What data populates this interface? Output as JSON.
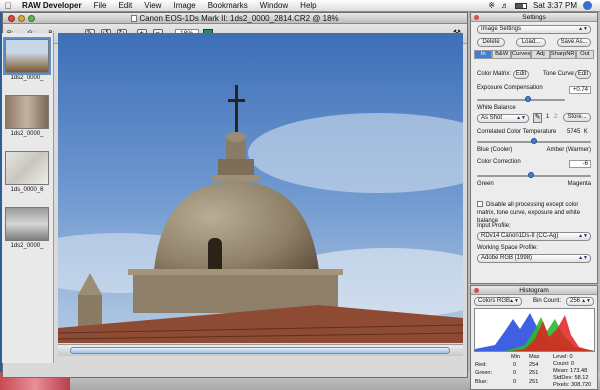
{
  "menubar": {
    "app": "RAW Developer",
    "items": [
      "File",
      "Edit",
      "View",
      "Image",
      "Bookmarks",
      "Window",
      "Help"
    ],
    "clock": "Sat 3:37 PM"
  },
  "image_window": {
    "title": "Canon EOS-1Ds Mark II: 1ds2_0000_2814.CR2 @ 18%",
    "toolbar": {
      "r_label": "R:",
      "g_label": "G:",
      "b_label": "B:",
      "zoom": "18%"
    },
    "thumbnails": [
      {
        "label": "1ds2_0000_"
      },
      {
        "label": "1ds2_0000_"
      },
      {
        "label": "1ds_0000_6"
      },
      {
        "label": "1ds2_0000_"
      }
    ]
  },
  "settings": {
    "title": "Settings",
    "preset": "Image Settings",
    "buttons": {
      "delete": "Delete",
      "load": "Load...",
      "save_as": "Save As..."
    },
    "tabs": [
      "In",
      "B&W",
      "Curves",
      "Adj",
      "SharpNR",
      "Out"
    ],
    "active_tab": "In",
    "color_matrix_label": "Color Matrix:",
    "color_matrix_btn": "Edit",
    "tone_curve_label": "Tone Curve:",
    "tone_curve_btn": "Edit",
    "exposure_label": "Exposure Compensation",
    "exposure_value": "+0.74",
    "exposure_level": 0.58,
    "wb_label": "White Balance",
    "wb_value": "As Shot",
    "wb_slot1": "1",
    "wb_slot2": "2",
    "store_btn": "Store...",
    "cct_label": "Correlated Color Temperature",
    "cct_value": "5745",
    "cct_unit": "K",
    "cct_level": 0.5,
    "cct_left": "Blue (Cooler)",
    "cct_right": "Amber (Warmer)",
    "cc_label": "Color Correction",
    "cc_value": "-6",
    "cc_level": 0.47,
    "cc_left": "Green",
    "cc_right": "Magenta",
    "disable_text": "Disable all processing except color matrix, tone curve, exposure and white balance",
    "input_profile_label": "Input Profile:",
    "input_profile_value": "RDv14 Canon1Ds-II (CC-Ag)",
    "ws_profile_label": "Working Space Profile:",
    "ws_profile_value": "Adobe RGB (1998)"
  },
  "histogram": {
    "title": "Histogram",
    "mode": "Colors RGB",
    "bin_label": "Bin Count:",
    "bin_value": "256",
    "headers": {
      "min": "Min",
      "max": "Max"
    },
    "rows": [
      {
        "label": "Red:",
        "min": "0",
        "max": "254"
      },
      {
        "label": "Green:",
        "min": "0",
        "max": "251"
      },
      {
        "label": "Blue:",
        "min": "0",
        "max": "251"
      }
    ],
    "stats": {
      "level": "Level: 0",
      "count": "Count: 0",
      "mean": "Mean: 173.48",
      "stddev": "StdDev: 58.12",
      "pixels": "Pixels: 308,720"
    },
    "colors": {
      "red": "#e02020",
      "green": "#2fb52f",
      "blue": "#2b4fe0"
    }
  }
}
